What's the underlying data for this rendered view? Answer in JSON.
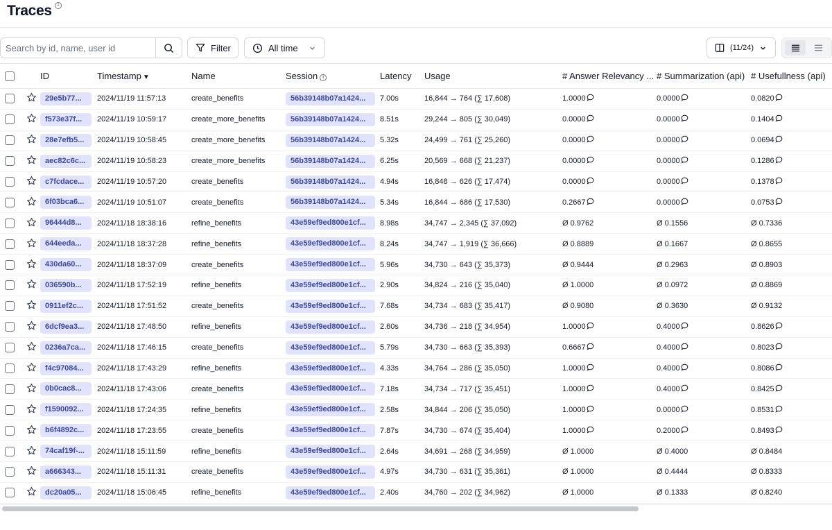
{
  "page": {
    "title": "Traces"
  },
  "toolbar": {
    "search_placeholder": "Search by id, name, user id",
    "filter_label": "Filter",
    "time_range_label": "All time",
    "columns_label": "(11/24)"
  },
  "table": {
    "headers": {
      "id": "ID",
      "timestamp": "Timestamp",
      "timestamp_sort": "▼",
      "name": "Name",
      "session": "Session",
      "latency": "Latency",
      "usage": "Usage",
      "answer_relevancy": "# Answer Relevancy ...",
      "summarization": "# Summarization (api)",
      "usefulness": "# Usefullness (api)"
    },
    "rows": [
      {
        "id": "29e5b77...",
        "ts": "2024/11/19 11:57:13",
        "name": "create_benefits",
        "session": "56b39148b07a1424...",
        "latency": "7.00s",
        "usage": "16,844 → 764 (∑ 17,608)",
        "rel": "1.0000",
        "rel_c": true,
        "sum": "0.0000",
        "sum_c": true,
        "use": "0.0820",
        "use_c": true
      },
      {
        "id": "f573e37f...",
        "ts": "2024/11/19 10:59:17",
        "name": "create_more_benefits",
        "session": "56b39148b07a1424...",
        "latency": "8.51s",
        "usage": "29,244 → 805 (∑ 30,049)",
        "rel": "0.0000",
        "rel_c": true,
        "sum": "0.0000",
        "sum_c": true,
        "use": "0.1404",
        "use_c": true
      },
      {
        "id": "28e7efb5...",
        "ts": "2024/11/19 10:58:45",
        "name": "create_more_benefits",
        "session": "56b39148b07a1424...",
        "latency": "5.32s",
        "usage": "24,499 → 761 (∑ 25,260)",
        "rel": "0.0000",
        "rel_c": true,
        "sum": "0.0000",
        "sum_c": true,
        "use": "0.0694",
        "use_c": true
      },
      {
        "id": "aec82c6c...",
        "ts": "2024/11/19 10:58:23",
        "name": "create_more_benefits",
        "session": "56b39148b07a1424...",
        "latency": "6.25s",
        "usage": "20,569 → 668 (∑ 21,237)",
        "rel": "0.0000",
        "rel_c": true,
        "sum": "0.0000",
        "sum_c": true,
        "use": "0.1286",
        "use_c": true
      },
      {
        "id": "c7fcdace...",
        "ts": "2024/11/19 10:57:20",
        "name": "create_benefits",
        "session": "56b39148b07a1424...",
        "latency": "4.94s",
        "usage": "16,848 → 626 (∑ 17,474)",
        "rel": "0.0000",
        "rel_c": true,
        "sum": "0.0000",
        "sum_c": true,
        "use": "0.1378",
        "use_c": true
      },
      {
        "id": "6f03bca6...",
        "ts": "2024/11/19 10:51:07",
        "name": "create_benefits",
        "session": "56b39148b07a1424...",
        "latency": "5.34s",
        "usage": "16,844 → 686 (∑ 17,530)",
        "rel": "0.2667",
        "rel_c": true,
        "sum": "0.0000",
        "sum_c": true,
        "use": "0.0753",
        "use_c": true
      },
      {
        "id": "96444d8...",
        "ts": "2024/11/18 18:38:16",
        "name": "refine_benefits",
        "session": "43e59ef9ed800e1cf...",
        "latency": "8.98s",
        "usage": "34,747 → 2,345 (∑ 37,092)",
        "rel": "Ø 0.9762",
        "rel_c": false,
        "sum": "Ø 0.1556",
        "sum_c": false,
        "use": "Ø 0.7336",
        "use_c": false
      },
      {
        "id": "644eeda...",
        "ts": "2024/11/18 18:37:28",
        "name": "refine_benefits",
        "session": "43e59ef9ed800e1cf...",
        "latency": "8.24s",
        "usage": "34,747 → 1,919 (∑ 36,666)",
        "rel": "Ø 0.8889",
        "rel_c": false,
        "sum": "Ø 0.1667",
        "sum_c": false,
        "use": "Ø 0.8655",
        "use_c": false
      },
      {
        "id": "430da60...",
        "ts": "2024/11/18 18:37:09",
        "name": "create_benefits",
        "session": "43e59ef9ed800e1cf...",
        "latency": "5.96s",
        "usage": "34,730 → 643 (∑ 35,373)",
        "rel": "Ø 0.9444",
        "rel_c": false,
        "sum": "Ø 0.2963",
        "sum_c": false,
        "use": "Ø 0.8903",
        "use_c": false
      },
      {
        "id": "036590b...",
        "ts": "2024/11/18 17:52:19",
        "name": "refine_benefits",
        "session": "43e59ef9ed800e1cf...",
        "latency": "2.90s",
        "usage": "34,824 → 216 (∑ 35,040)",
        "rel": "Ø 1.0000",
        "rel_c": false,
        "sum": "Ø 0.0972",
        "sum_c": false,
        "use": "Ø 0.8869",
        "use_c": false
      },
      {
        "id": "0911ef2c...",
        "ts": "2024/11/18 17:51:52",
        "name": "create_benefits",
        "session": "43e59ef9ed800e1cf...",
        "latency": "7.68s",
        "usage": "34,734 → 683 (∑ 35,417)",
        "rel": "Ø 0.9080",
        "rel_c": false,
        "sum": "Ø 0.3630",
        "sum_c": false,
        "use": "Ø 0.9132",
        "use_c": false
      },
      {
        "id": "6dcf9ea3...",
        "ts": "2024/11/18 17:48:50",
        "name": "refine_benefits",
        "session": "43e59ef9ed800e1cf...",
        "latency": "2.60s",
        "usage": "34,736 → 218 (∑ 34,954)",
        "rel": "1.0000",
        "rel_c": true,
        "sum": "0.4000",
        "sum_c": true,
        "use": "0.8626",
        "use_c": true
      },
      {
        "id": "0236a7ca...",
        "ts": "2024/11/18 17:46:15",
        "name": "create_benefits",
        "session": "43e59ef9ed800e1cf...",
        "latency": "5.79s",
        "usage": "34,730 → 663 (∑ 35,393)",
        "rel": "0.6667",
        "rel_c": true,
        "sum": "0.4000",
        "sum_c": true,
        "use": "0.8023",
        "use_c": true
      },
      {
        "id": "f4c97084...",
        "ts": "2024/11/18 17:43:29",
        "name": "refine_benefits",
        "session": "43e59ef9ed800e1cf...",
        "latency": "4.33s",
        "usage": "34,764 → 286 (∑ 35,050)",
        "rel": "1.0000",
        "rel_c": true,
        "sum": "0.4000",
        "sum_c": true,
        "use": "0.8086",
        "use_c": true
      },
      {
        "id": "0b0cac8...",
        "ts": "2024/11/18 17:43:06",
        "name": "create_benefits",
        "session": "43e59ef9ed800e1cf...",
        "latency": "7.18s",
        "usage": "34,734 → 717 (∑ 35,451)",
        "rel": "1.0000",
        "rel_c": true,
        "sum": "0.4000",
        "sum_c": true,
        "use": "0.8425",
        "use_c": true
      },
      {
        "id": "f1590092...",
        "ts": "2024/11/18 17:24:35",
        "name": "refine_benefits",
        "session": "43e59ef9ed800e1cf...",
        "latency": "2.58s",
        "usage": "34,844 → 206 (∑ 35,050)",
        "rel": "1.0000",
        "rel_c": true,
        "sum": "0.0000",
        "sum_c": true,
        "use": "0.8531",
        "use_c": true
      },
      {
        "id": "b6f4892c...",
        "ts": "2024/11/18 17:23:55",
        "name": "create_benefits",
        "session": "43e59ef9ed800e1cf...",
        "latency": "7.87s",
        "usage": "34,730 → 674 (∑ 35,404)",
        "rel": "1.0000",
        "rel_c": true,
        "sum": "0.2000",
        "sum_c": true,
        "use": "0.8493",
        "use_c": true
      },
      {
        "id": "74caf19f-...",
        "ts": "2024/11/18 15:11:59",
        "name": "refine_benefits",
        "session": "43e59ef9ed800e1cf...",
        "latency": "2.64s",
        "usage": "34,691 → 268 (∑ 34,959)",
        "rel": "Ø 1.0000",
        "rel_c": false,
        "sum": "Ø 0.4000",
        "sum_c": false,
        "use": "Ø 0.8484",
        "use_c": false
      },
      {
        "id": "a666343...",
        "ts": "2024/11/18 15:11:31",
        "name": "create_benefits",
        "session": "43e59ef9ed800e1cf...",
        "latency": "4.97s",
        "usage": "34,730 → 631 (∑ 35,361)",
        "rel": "Ø 1.0000",
        "rel_c": false,
        "sum": "Ø 0.4444",
        "sum_c": false,
        "use": "Ø 0.8333",
        "use_c": false
      },
      {
        "id": "dc20a05...",
        "ts": "2024/11/18 15:06:45",
        "name": "refine_benefits",
        "session": "43e59ef9ed800e1cf...",
        "latency": "2.40s",
        "usage": "34,760 → 202 (∑ 34,962)",
        "rel": "Ø 1.0000",
        "rel_c": false,
        "sum": "Ø 0.1333",
        "sum_c": false,
        "use": "Ø 0.8240",
        "use_c": false
      }
    ]
  },
  "icons": {
    "search": "search-icon",
    "filter": "filter-icon",
    "clock": "clock-icon",
    "chevron": "chevron-down-icon",
    "columns": "columns-icon",
    "star": "star-icon",
    "comment": "comment-icon",
    "info": "info-icon"
  },
  "colors": {
    "pill_bg": "#e0e3fb",
    "pill_text": "#3d4a98",
    "border": "#d1d5db"
  }
}
